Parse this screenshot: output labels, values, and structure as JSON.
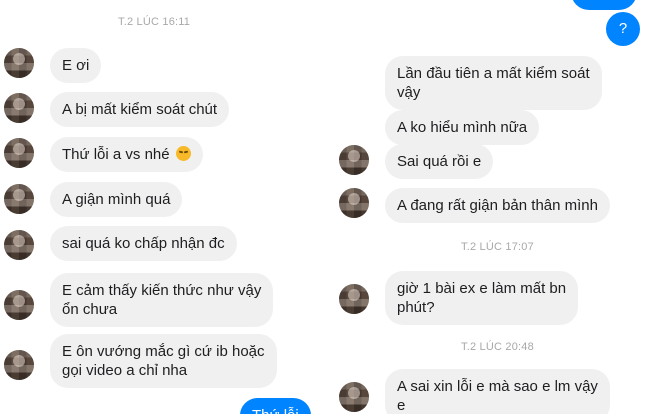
{
  "left": {
    "timestamp": "T.2 LÚC 16:11",
    "messages": [
      "E ơi",
      "A bị mất kiểm soát chút",
      "Thứ lỗi a vs nhé",
      "A giận mình quá",
      "sai quá ko chấp nhận đc",
      "E cảm thấy kiến thức như vậy\nổn chưa",
      "E ôn vướng mắc gì cứ ib hoặc\ngọi video a chỉ nha"
    ],
    "outgoing": "Thứ lỗi"
  },
  "right": {
    "outgoing_top": "?",
    "messages_1": [
      "Lần đầu tiên a mất kiểm soát\nvậy",
      "A ko hiểu mình nữa",
      "Sai quá rồi e",
      "A đang rất giận bản thân mình"
    ],
    "timestamp_2": "T.2 LÚC 17:07",
    "message_2": "giờ 1 bài ex e làm mất bn\nphút?",
    "timestamp_3": "T.2 LÚC 20:48",
    "message_3": "A sai xin lỗi e mà sao e lm vậy\ne"
  },
  "icons": {
    "emoji": "disappointed-face-emoji"
  },
  "colors": {
    "incoming_bubble": "#f1f0f0",
    "outgoing_bubble": "#0084ff",
    "timestamp": "#a8a8a8"
  }
}
